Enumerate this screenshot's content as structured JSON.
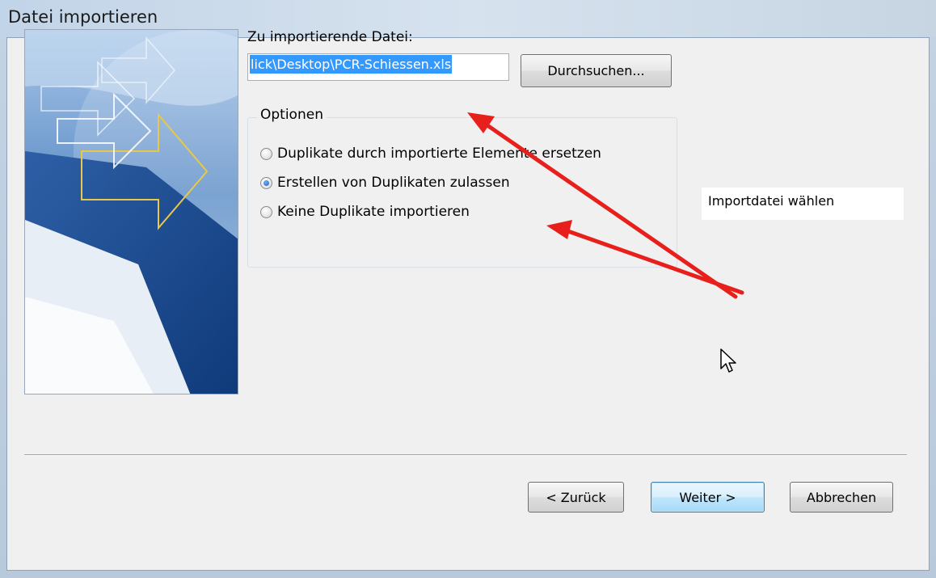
{
  "window": {
    "title": "Datei importieren"
  },
  "file": {
    "label": "Zu importierende Datei:",
    "value": "lick\\Desktop\\PCR-Schiessen.xls",
    "browse_label": "Durchsuchen..."
  },
  "options": {
    "legend": "Optionen",
    "items": [
      {
        "label": "Duplikate durch importierte Elemente ersetzen",
        "checked": false
      },
      {
        "label": "Erstellen von Duplikaten zulassen",
        "checked": true
      },
      {
        "label": "Keine Duplikate importieren",
        "checked": false
      }
    ]
  },
  "annotation": {
    "note": "Importdatei wählen",
    "arrow_color": "#e8201c"
  },
  "footer": {
    "back_label": "< Zurück",
    "next_label": "Weiter >",
    "cancel_label": "Abbrechen"
  },
  "icons": [
    "import-arrow-illustration",
    "mouse-cursor-icon"
  ]
}
